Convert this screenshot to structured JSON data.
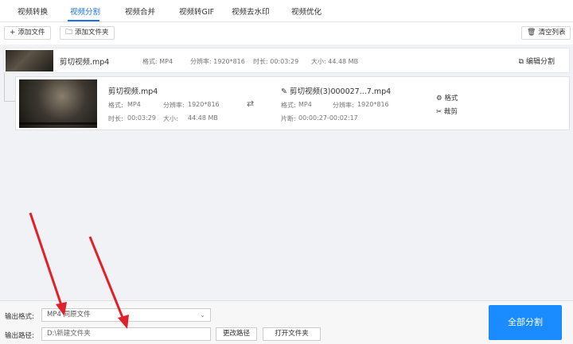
{
  "tabs": [
    "视频转换",
    "视频分割",
    "视频合并",
    "视频转GIF",
    "视频去水印",
    "视频优化"
  ],
  "toolbar": {
    "add_file": "添加文件",
    "add_folder": "添加文件夹",
    "clear_list": "清空列表"
  },
  "source": {
    "name": "剪切视频.mp4",
    "format": "格式: MP4",
    "resolution": "分辨率: 1920*816",
    "duration": "时长: 00:03:29",
    "size": "大小: 44.48 MB",
    "action": "编辑分割"
  },
  "clip": {
    "name": "剪切视频.mp4",
    "format_label": "格式:",
    "format_value": "MP4",
    "resolution_label": "分辨率:",
    "resolution_value": "1920*816",
    "duration_label": "时长:",
    "duration_value": "00:03:29",
    "size_label": "大小:",
    "size_value": "44.48 MB",
    "output_name": "剪切视频(3)000027...7.mp4",
    "out_format_label": "格式:",
    "out_format_value": "MP4",
    "out_resolution_label": "分辨率:",
    "out_resolution_value": "1920*816",
    "segment_label": "片断:",
    "segment_value": "00:00:27-00:02:17",
    "settings": "格式",
    "cut": "裁剪"
  },
  "bottom": {
    "format_label": "输出格式:",
    "format_value": "MP4  同原文件",
    "path_label": "输出路径:",
    "path_value": "D:\\新建文件夹",
    "change_path": "更改路径",
    "open_folder": "打开文件夹",
    "start": "全部分割"
  },
  "colors": {
    "accent": "#1a73e8",
    "start_button": "#1a8cff",
    "arrow": "#e0202a"
  }
}
